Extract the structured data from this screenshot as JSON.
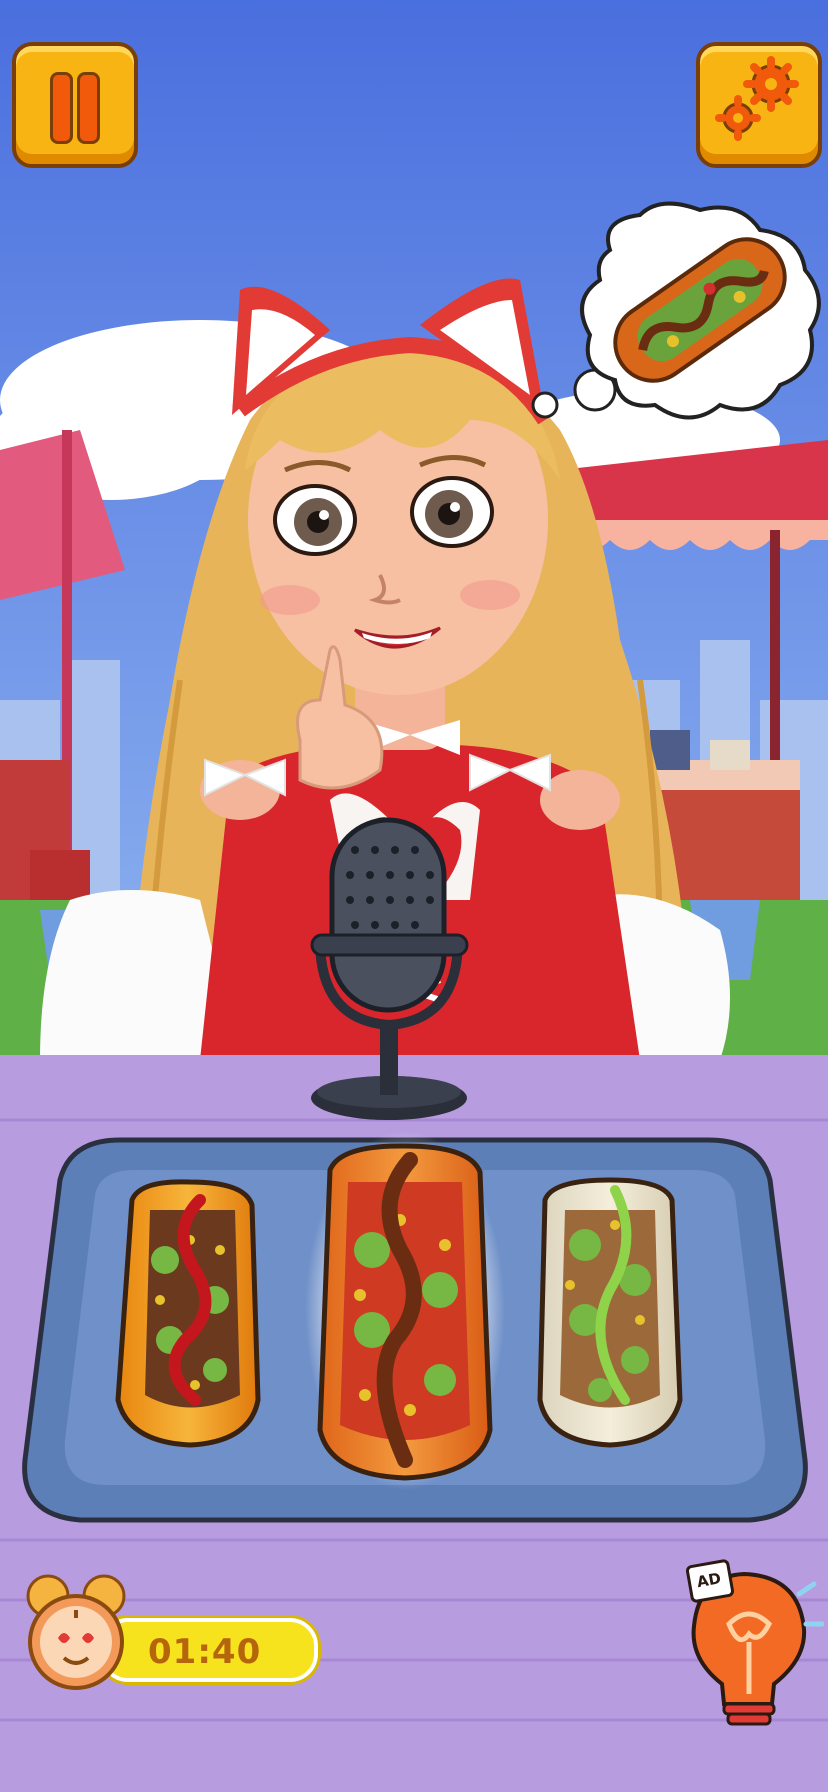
{
  "hud": {
    "pause_icon": "pause-icon",
    "settings_icon": "gear-icon",
    "timer_icon": "alarm-clock-icon",
    "timer_value": "01:40",
    "hint_icon": "lightbulb-icon",
    "hint_badge": "AD"
  },
  "scene": {
    "character": "girl-with-cat-ear-headband",
    "thought_bubble_item": "burrito",
    "tray_items": [
      "burrito-option-1",
      "burrito-option-2",
      "burrito-option-3"
    ],
    "selected_index": 1
  },
  "colors": {
    "sky": "#5479e0",
    "table": "#b79ce0",
    "button": "#f7b413",
    "accent": "#f05a0a",
    "timer_bar": "#f6e21d"
  }
}
